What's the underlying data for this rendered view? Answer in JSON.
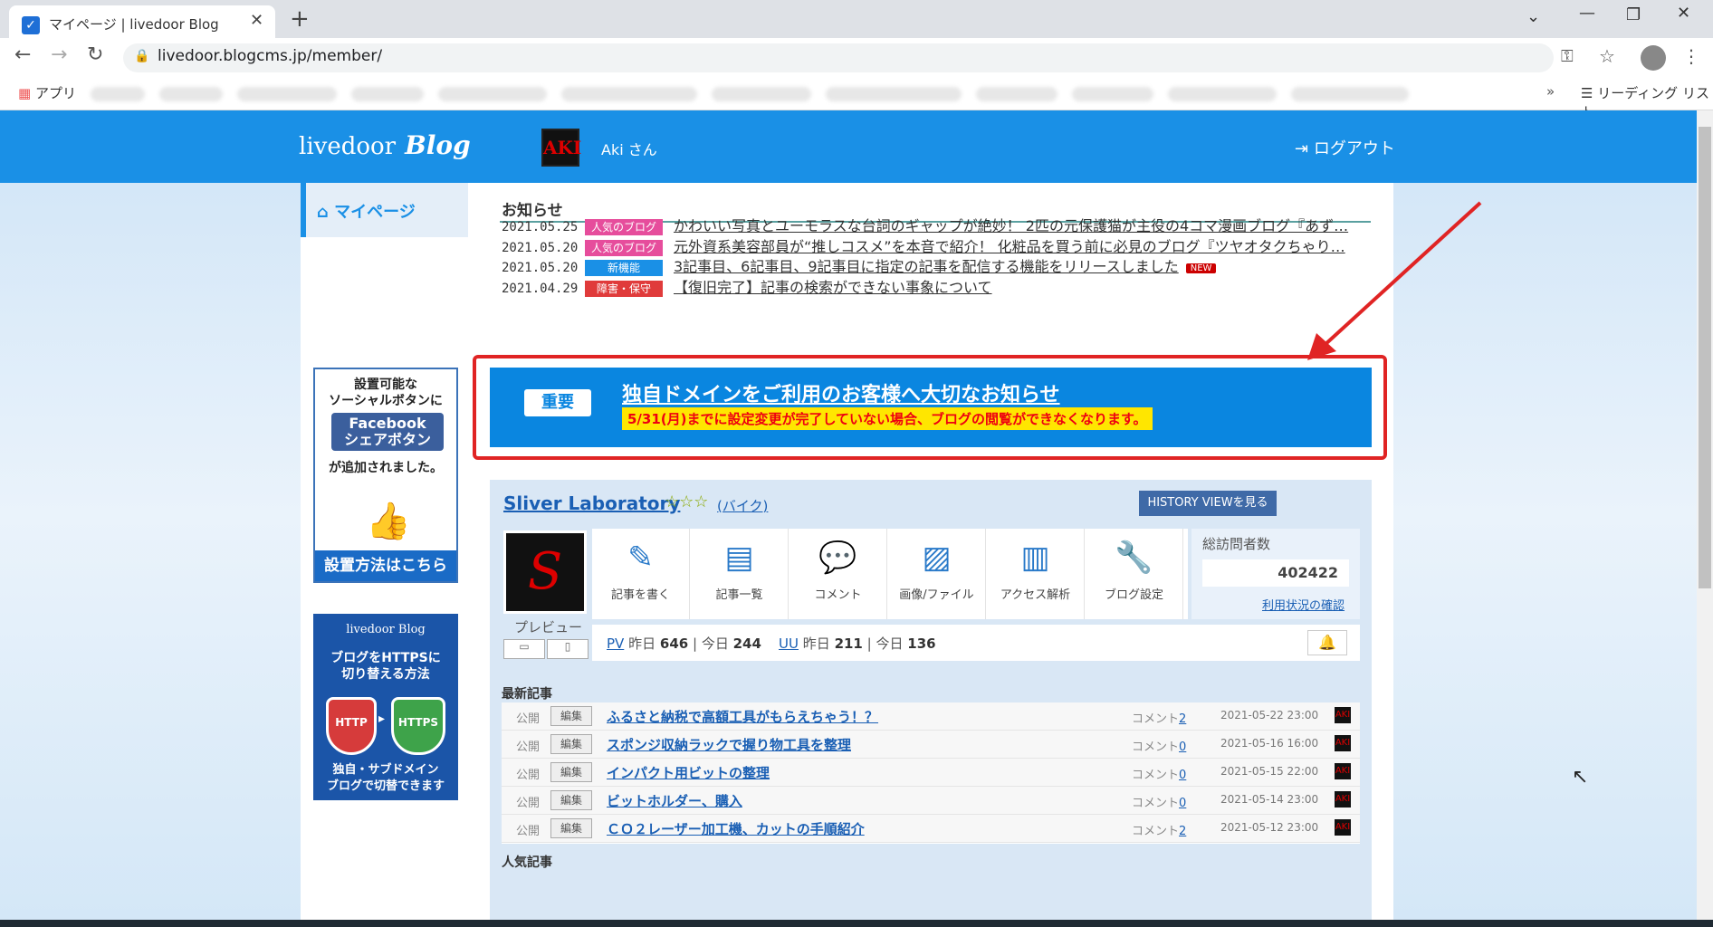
{
  "browser": {
    "tab_title": "マイページ | livedoor Blog",
    "url": "livedoor.blogcms.jp/member/",
    "apps_label": "アプリ",
    "reading_list_label": "リーディング リスト"
  },
  "header": {
    "logo_text": "livedoor",
    "logo_script": "Blog",
    "avatar_text": "AKI",
    "username": "Aki さん",
    "logout_label": "ログアウト"
  },
  "sidebar": {
    "mypage_label": "マイページ",
    "fb_banner": {
      "title": "設置可能な\nソーシャルボタンに",
      "button": "Facebook\nシェアボタン",
      "added": "が追加されました。",
      "cta": "設置方法はこちら"
    },
    "https_banner": {
      "logo": "livedoor Blog",
      "title": "ブログをHTTPSに\n切り替える方法",
      "http": "HTTP",
      "https": "HTTPS",
      "bottom": "独自・サブドメイン\nブログで切替できます"
    }
  },
  "news": {
    "heading": "お知らせ",
    "items": [
      {
        "date": "2021.05.25",
        "tag": "人気のブログ",
        "tag_color": "#e64d9c",
        "text": "かわいい写真とユーモラスな台詞のギャップが絶妙！ 2匹の元保護猫が主役の4コマ漫画ブログ『あず…"
      },
      {
        "date": "2021.05.20",
        "tag": "人気のブログ",
        "tag_color": "#e64d9c",
        "text": "元外資系美容部員が“推しコスメ”を本音で紹介！ 化粧品を買う前に必見のブログ『ツヤオタクちゃり…"
      },
      {
        "date": "2021.05.20",
        "tag": "新機能",
        "tag_color": "#1a90e6",
        "text": "3記事目、6記事目、9記事目に指定の記事を配信する機能をリリースしました",
        "new": "NEW"
      },
      {
        "date": "2021.04.29",
        "tag": "障害・保守",
        "tag_color": "#e03b3b",
        "text": "【復旧完了】記事の検索ができない事象について"
      }
    ]
  },
  "notice": {
    "tag": "重要",
    "title": "独自ドメインをご利用のお客様へ大切なお知らせ",
    "subtitle": "5/31(月)までに設定変更が完了していない場合、ブログの閲覧ができなくなります。"
  },
  "blog": {
    "title": "Sliver Laboratory",
    "stars": "☆☆☆",
    "category": "(バイク)",
    "history_button": "HISTORY VIEWを見る",
    "thumb_glyph": "S",
    "preview_label": "プレビュー",
    "tools": [
      {
        "icon": "pen-icon",
        "glyph": "✎",
        "label": "記事を書く"
      },
      {
        "icon": "list-icon",
        "glyph": "▤",
        "label": "記事一覧"
      },
      {
        "icon": "comment-icon",
        "glyph": "💬",
        "label": "コメント"
      },
      {
        "icon": "image-icon",
        "glyph": "▨",
        "label": "画像/ファイル"
      },
      {
        "icon": "chart-icon",
        "glyph": "▥",
        "label": "アクセス解析"
      },
      {
        "icon": "wrench-icon",
        "glyph": "🔧",
        "label": "ブログ設定"
      }
    ],
    "visitors_label": "総訪問者数",
    "visitors_count": "402422",
    "usage_link": "利用状況の確認",
    "stats": {
      "pv": "PV",
      "pv_yesterday_label": "昨日",
      "pv_yesterday": "646",
      "pv_today_label": "今日",
      "pv_today": "244",
      "uu": "UU",
      "uu_yesterday_label": "昨日",
      "uu_yesterday": "211",
      "uu_today_label": "今日",
      "uu_today": "136"
    }
  },
  "latest": {
    "heading": "最新記事",
    "status_label": "公開",
    "edit_label": "編集",
    "comment_label": "コメント",
    "items": [
      {
        "title": "ふるさと納税で高額工具がもらえちゃう！？",
        "comments": "2",
        "date": "2021-05-22 23:00"
      },
      {
        "title": "スポンジ収納ラックで握り物工具を整理",
        "comments": "0",
        "date": "2021-05-16 16:00"
      },
      {
        "title": "インパクト用ビットの整理",
        "comments": "0",
        "date": "2021-05-15 22:00"
      },
      {
        "title": "ビットホルダー、購入",
        "comments": "0",
        "date": "2021-05-14 23:00"
      },
      {
        "title": "ＣＯ２レーザー加工機、カットの手順紹介",
        "comments": "2",
        "date": "2021-05-12 23:00"
      }
    ]
  },
  "popular_heading": "人気記事",
  "colors": {
    "header_blue": "#1a90e6",
    "notice_blue": "#0a86e0",
    "highlight_red": "#e02424"
  }
}
